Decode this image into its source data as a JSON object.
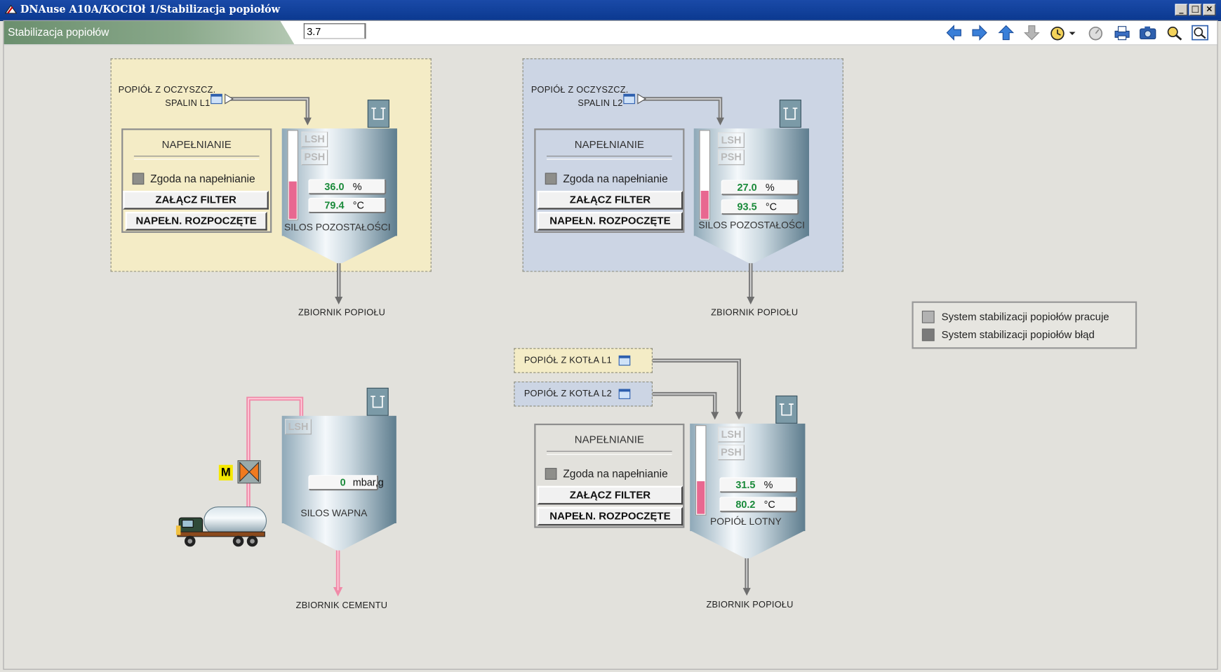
{
  "window": {
    "title": "DNAuse A10A/KOCIOł 1/Stabilizacja popiołów"
  },
  "toolbar": {
    "page_name": "Stabilizacja popiołów",
    "version_field": "3.7",
    "icons": [
      "arrow-left-icon",
      "arrow-right-icon",
      "arrow-up-icon",
      "arrow-down-icon",
      "history-clock-icon",
      "timer-icon",
      "print-icon",
      "camera-icon",
      "zoom-fit-icon",
      "zoom-icon"
    ]
  },
  "silo_l1": {
    "source_label_1": "POPIÓŁ Z OCZYSZCZ.",
    "source_label_2": "SPALIN L1",
    "control": {
      "header": "NAPEŁNIANIE",
      "consent_label": "Zgoda na napełnianie",
      "filter_button": "ZAŁĄCZ FILTER",
      "start_button": "NAPEŁN. ROZPOCZĘTE"
    },
    "lsh": "LSH",
    "psh": "PSH",
    "level_value": "36.0",
    "level_unit": "%",
    "level_fraction": 0.36,
    "temp_value": "79.4",
    "temp_unit": "°C",
    "name": "SILOS POZOSTAŁOŚCI",
    "outlet_label": "ZBIORNIK POPIOŁU",
    "colors": {
      "panel": "#f4ecc6"
    }
  },
  "silo_l2": {
    "source_label_1": "POPIÓŁ Z OCZYSZCZ.",
    "source_label_2": "SPALIN L2",
    "control": {
      "header": "NAPEŁNIANIE",
      "consent_label": "Zgoda na napełnianie",
      "filter_button": "ZAŁĄCZ FILTER",
      "start_button": "NAPEŁN. ROZPOCZĘTE"
    },
    "lsh": "LSH",
    "psh": "PSH",
    "level_value": "27.0",
    "level_unit": "%",
    "level_fraction": 0.27,
    "temp_value": "93.5",
    "temp_unit": "°C",
    "name": "SILOS POZOSTAŁOŚCI",
    "outlet_label": "ZBIORNIK POPIOŁU",
    "colors": {
      "panel": "#ccd5e4"
    }
  },
  "lime_silo": {
    "lsh": "LSH",
    "pressure_value": "0",
    "pressure_unit": "mbar,g",
    "name": "SILOS WAPNA",
    "motor_label": "M",
    "outlet_label": "ZBIORNIK CEMENTU"
  },
  "fly_ash": {
    "source_kotla_l1": "POPIÓŁ Z KOTŁA L1",
    "source_kotla_l2": "POPIÓŁ Z KOTŁA L2",
    "control": {
      "header": "NAPEŁNIANIE",
      "consent_label": "Zgoda na napełnianie",
      "filter_button": "ZAŁĄCZ FILTER",
      "start_button": "NAPEŁN. ROZPOCZĘTE"
    },
    "lsh": "LSH",
    "psh": "PSH",
    "level_value": "31.5",
    "level_unit": "%",
    "level_fraction": 0.315,
    "temp_value": "80.2",
    "temp_unit": "°C",
    "name": "POPIÓŁ LOTNY",
    "outlet_label": "ZBIORNIK POPIOŁU"
  },
  "legend": {
    "working_label": "System stabilizacji popiołów pracuje",
    "error_label": "System stabilizacji popiołów błąd"
  }
}
